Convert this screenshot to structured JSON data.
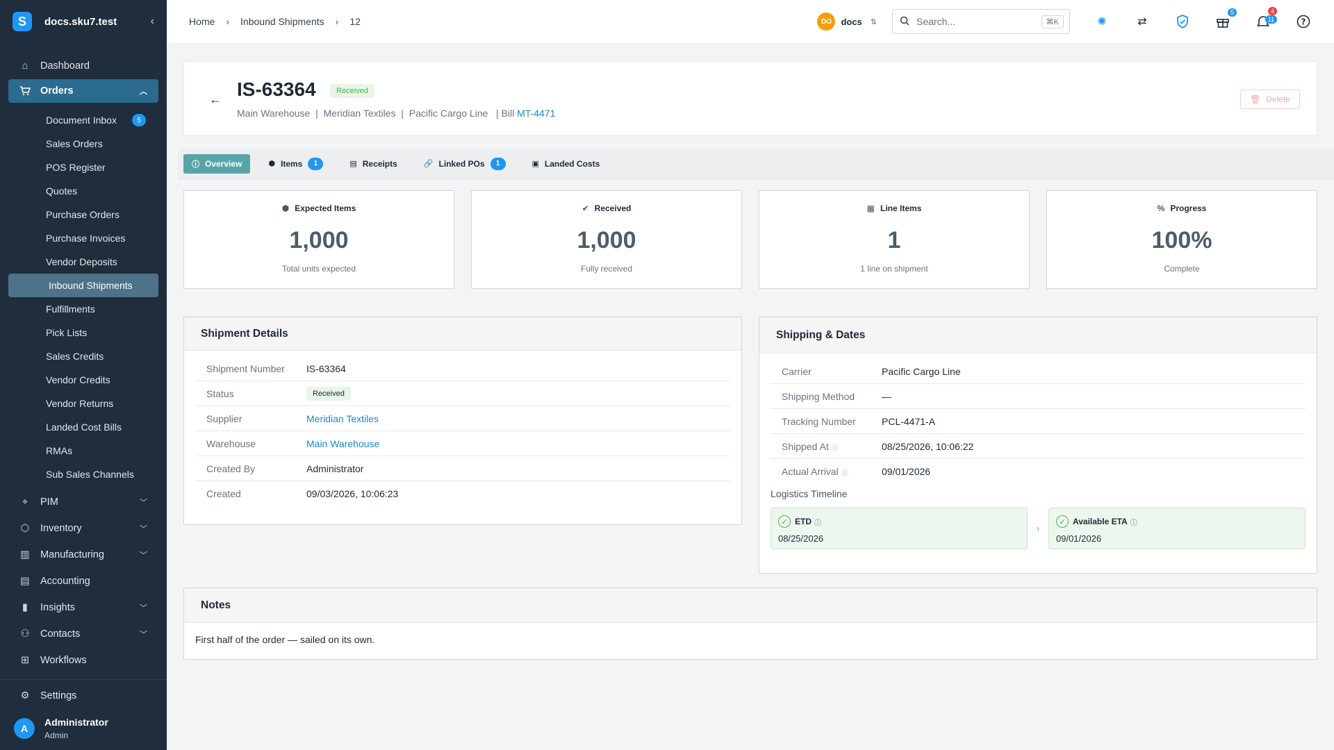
{
  "app": {
    "name": "docs.sku7.test",
    "logo_letter": "S"
  },
  "breadcrumb": [
    "Home",
    "Inbound Shipments",
    "12"
  ],
  "org": {
    "initials": "DO",
    "name": "docs"
  },
  "search": {
    "placeholder": "Search...",
    "shortcut": "⌘K"
  },
  "top_badges": {
    "gift": "5",
    "bell_red": "4",
    "bell_blue": "11"
  },
  "sidebar": {
    "dashboard": "Dashboard",
    "orders": "Orders",
    "order_items": [
      {
        "label": "Document Inbox",
        "badge": "5"
      },
      {
        "label": "Sales Orders"
      },
      {
        "label": "POS Register"
      },
      {
        "label": "Quotes"
      },
      {
        "label": "Purchase Orders"
      },
      {
        "label": "Purchase Invoices"
      },
      {
        "label": "Vendor Deposits"
      },
      {
        "label": "Inbound Shipments"
      },
      {
        "label": "Fulfillments"
      },
      {
        "label": "Pick Lists"
      },
      {
        "label": "Sales Credits"
      },
      {
        "label": "Vendor Credits"
      },
      {
        "label": "Vendor Returns"
      },
      {
        "label": "Landed Cost Bills"
      },
      {
        "label": "RMAs"
      },
      {
        "label": "Sub Sales Channels"
      }
    ],
    "pim": "PIM",
    "inventory": "Inventory",
    "manufacturing": "Manufacturing",
    "accounting": "Accounting",
    "insights": "Insights",
    "contacts": "Contacts",
    "workflows": "Workflows",
    "settings": "Settings"
  },
  "user": {
    "initial": "A",
    "name": "Administrator",
    "role": "Admin"
  },
  "shipment": {
    "number": "IS-63364",
    "status": "Received",
    "warehouse": "Main Warehouse",
    "supplier": "Meridian Textiles",
    "carrier": "Pacific Cargo Line",
    "bill_prefix": "| Bill",
    "bill": "MT-4471",
    "delete_label": "Delete"
  },
  "tabs": [
    {
      "label": "Overview"
    },
    {
      "label": "Items",
      "badge": "1"
    },
    {
      "label": "Receipts"
    },
    {
      "label": "Linked POs",
      "badge": "1"
    },
    {
      "label": "Landed Costs"
    }
  ],
  "stats": [
    {
      "label": "Expected Items",
      "value": "1,000",
      "caption": "Total units expected"
    },
    {
      "label": "Received",
      "value": "1,000",
      "caption": "Fully received"
    },
    {
      "label": "Line Items",
      "value": "1",
      "caption": "1 line on shipment"
    },
    {
      "label": "Progress",
      "value": "100%",
      "caption": "Complete"
    }
  ],
  "details": {
    "title": "Shipment Details",
    "rows": [
      {
        "k": "Shipment Number",
        "v": "IS-63364"
      },
      {
        "k": "Status",
        "v": "Received"
      },
      {
        "k": "Supplier",
        "v": "Meridian Textiles"
      },
      {
        "k": "Warehouse",
        "v": "Main Warehouse"
      },
      {
        "k": "Created By",
        "v": "Administrator"
      },
      {
        "k": "Created",
        "v": "09/03/2026, 10:06:23"
      }
    ]
  },
  "shipping": {
    "title": "Shipping & Dates",
    "rows": [
      {
        "k": "Carrier",
        "v": "Pacific Cargo Line"
      },
      {
        "k": "Shipping Method",
        "v": "—"
      },
      {
        "k": "Tracking Number",
        "v": "PCL-4471-A"
      },
      {
        "k": "Shipped At",
        "v": "08/25/2026, 10:06:22"
      },
      {
        "k": "Actual Arrival",
        "v": "09/01/2026"
      }
    ],
    "timeline_label": "Logistics Timeline",
    "etd_label": "ETD",
    "etd_value": "08/25/2026",
    "eta_label": "Available ETA",
    "eta_value": "09/01/2026"
  },
  "notes": {
    "title": "Notes",
    "text": "First half of the order — sailed on its own."
  }
}
